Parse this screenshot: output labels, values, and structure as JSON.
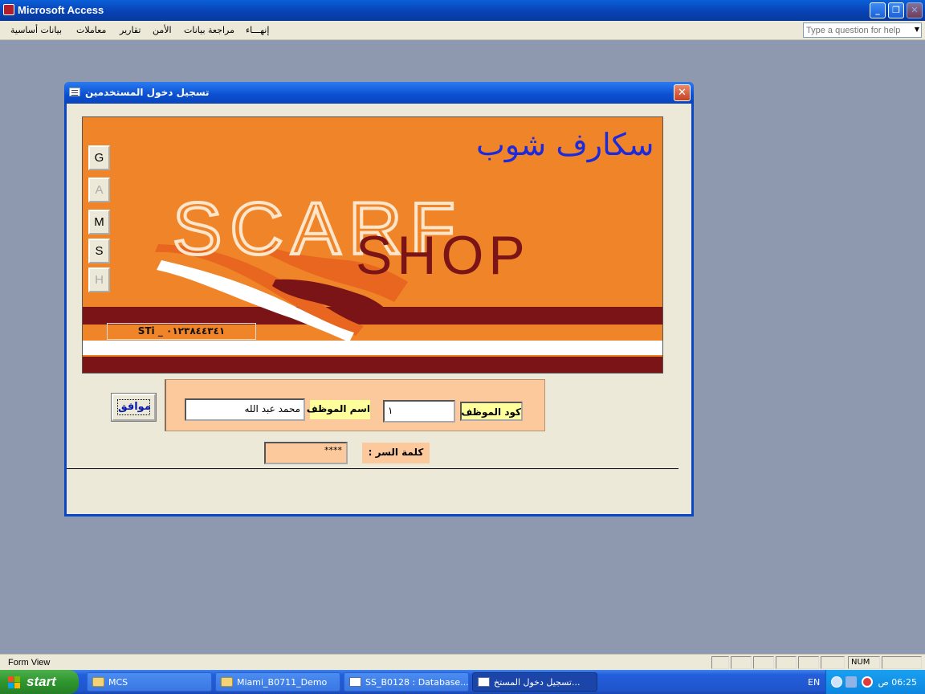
{
  "window": {
    "title": "Microsoft Access",
    "minimize_icon": "minimize-icon",
    "restore_icon": "restore-icon",
    "close_icon": "close-icon"
  },
  "menu": {
    "items": [
      "بيانات أساسية",
      "معاملات",
      "تقارير",
      "الأمن",
      "مراجعة بيانات",
      "إنهـــاء"
    ],
    "help_placeholder": "Type a question for help"
  },
  "form": {
    "title": "تسجيل دخول المستخدمين",
    "banner_title": "سكارف شوب",
    "banner_logo_top": "SCARF",
    "banner_logo_bottom": "SHOP",
    "side_buttons": [
      "G",
      "A",
      "M",
      "S",
      "H"
    ],
    "credit": "STi _ ٠١٢٣٨٤٤٣٤١",
    "ok_label": "موافق",
    "employee_code_label": "كود الموظف",
    "employee_code_value": "١",
    "employee_name_label": "اسم الموظف",
    "employee_name_value": "محمد عبد الله",
    "password_label": "كلمة السر :",
    "password_value": "****"
  },
  "statusbar": {
    "text": "Form View",
    "num_indicator": "NUM"
  },
  "taskbar": {
    "start_label": "start",
    "items": [
      {
        "label": "MCS",
        "icon": "folder-icon"
      },
      {
        "label": "Miami_B0711_Demo",
        "icon": "folder-icon"
      },
      {
        "label": "SS_B0128 : Database...",
        "icon": "database-icon"
      },
      {
        "label": "تسجيل دخول المستخ...",
        "icon": "form-icon"
      }
    ],
    "language": "EN",
    "clock": "06:25 ص"
  },
  "colors": {
    "banner_orange": "#f08428",
    "banner_maroon": "#7a1416",
    "banner_title_blue": "#1a2ae0",
    "login_panel": "#fcc99d",
    "label_yellow": "#ffff9c"
  }
}
